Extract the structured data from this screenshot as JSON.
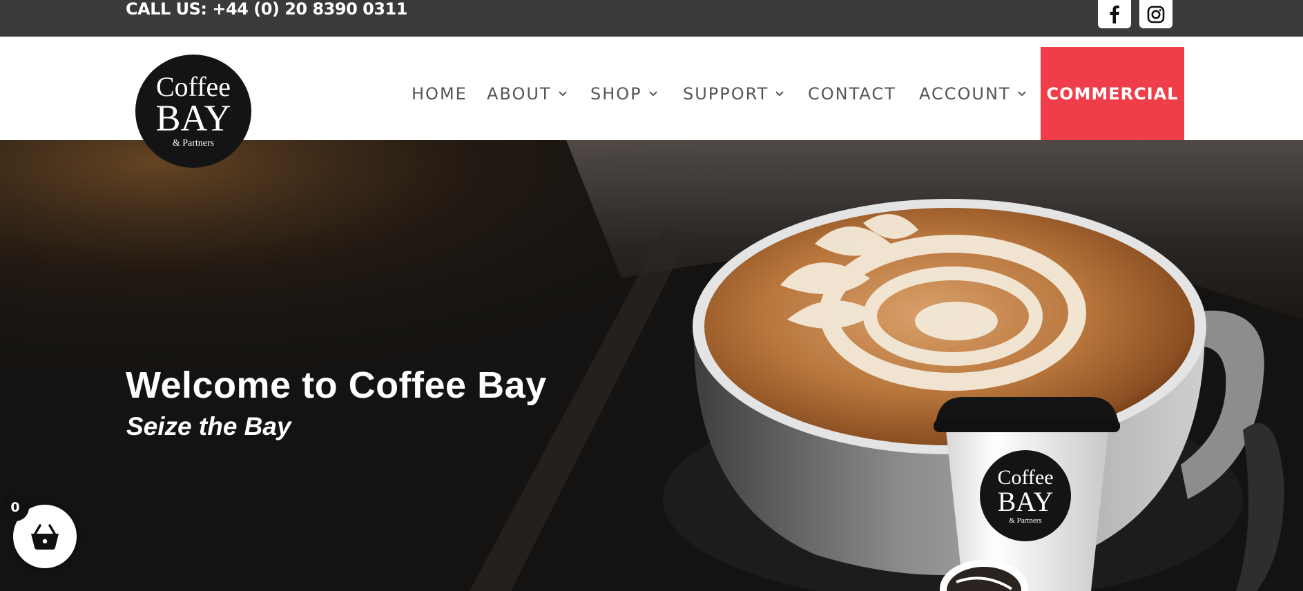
{
  "topbar": {
    "phone": "CALL US: +44 (0) 20 8390 0311",
    "social": [
      {
        "icon": "facebook-icon"
      },
      {
        "icon": "instagram-icon"
      }
    ]
  },
  "logo": {
    "line1": "Coffee",
    "line2": "BAY",
    "line3": "& Partners"
  },
  "nav": {
    "items": [
      {
        "label": "HOME",
        "dropdown": false
      },
      {
        "label": "ABOUT",
        "dropdown": true
      },
      {
        "label": "SHOP",
        "dropdown": true
      },
      {
        "label": "SUPPORT",
        "dropdown": true
      },
      {
        "label": "CONTACT",
        "dropdown": false
      },
      {
        "label": "ACCOUNT",
        "dropdown": true
      }
    ],
    "cta": "COMMERCIAL"
  },
  "hero": {
    "title": "Welcome to Coffee Bay",
    "subtitle": "Seize the Bay"
  },
  "cart": {
    "count": "0",
    "icon": "basket-icon"
  },
  "colors": {
    "topbar": "#3a3a3a",
    "accent": "#ef3e4a",
    "nav_text": "#555555"
  }
}
